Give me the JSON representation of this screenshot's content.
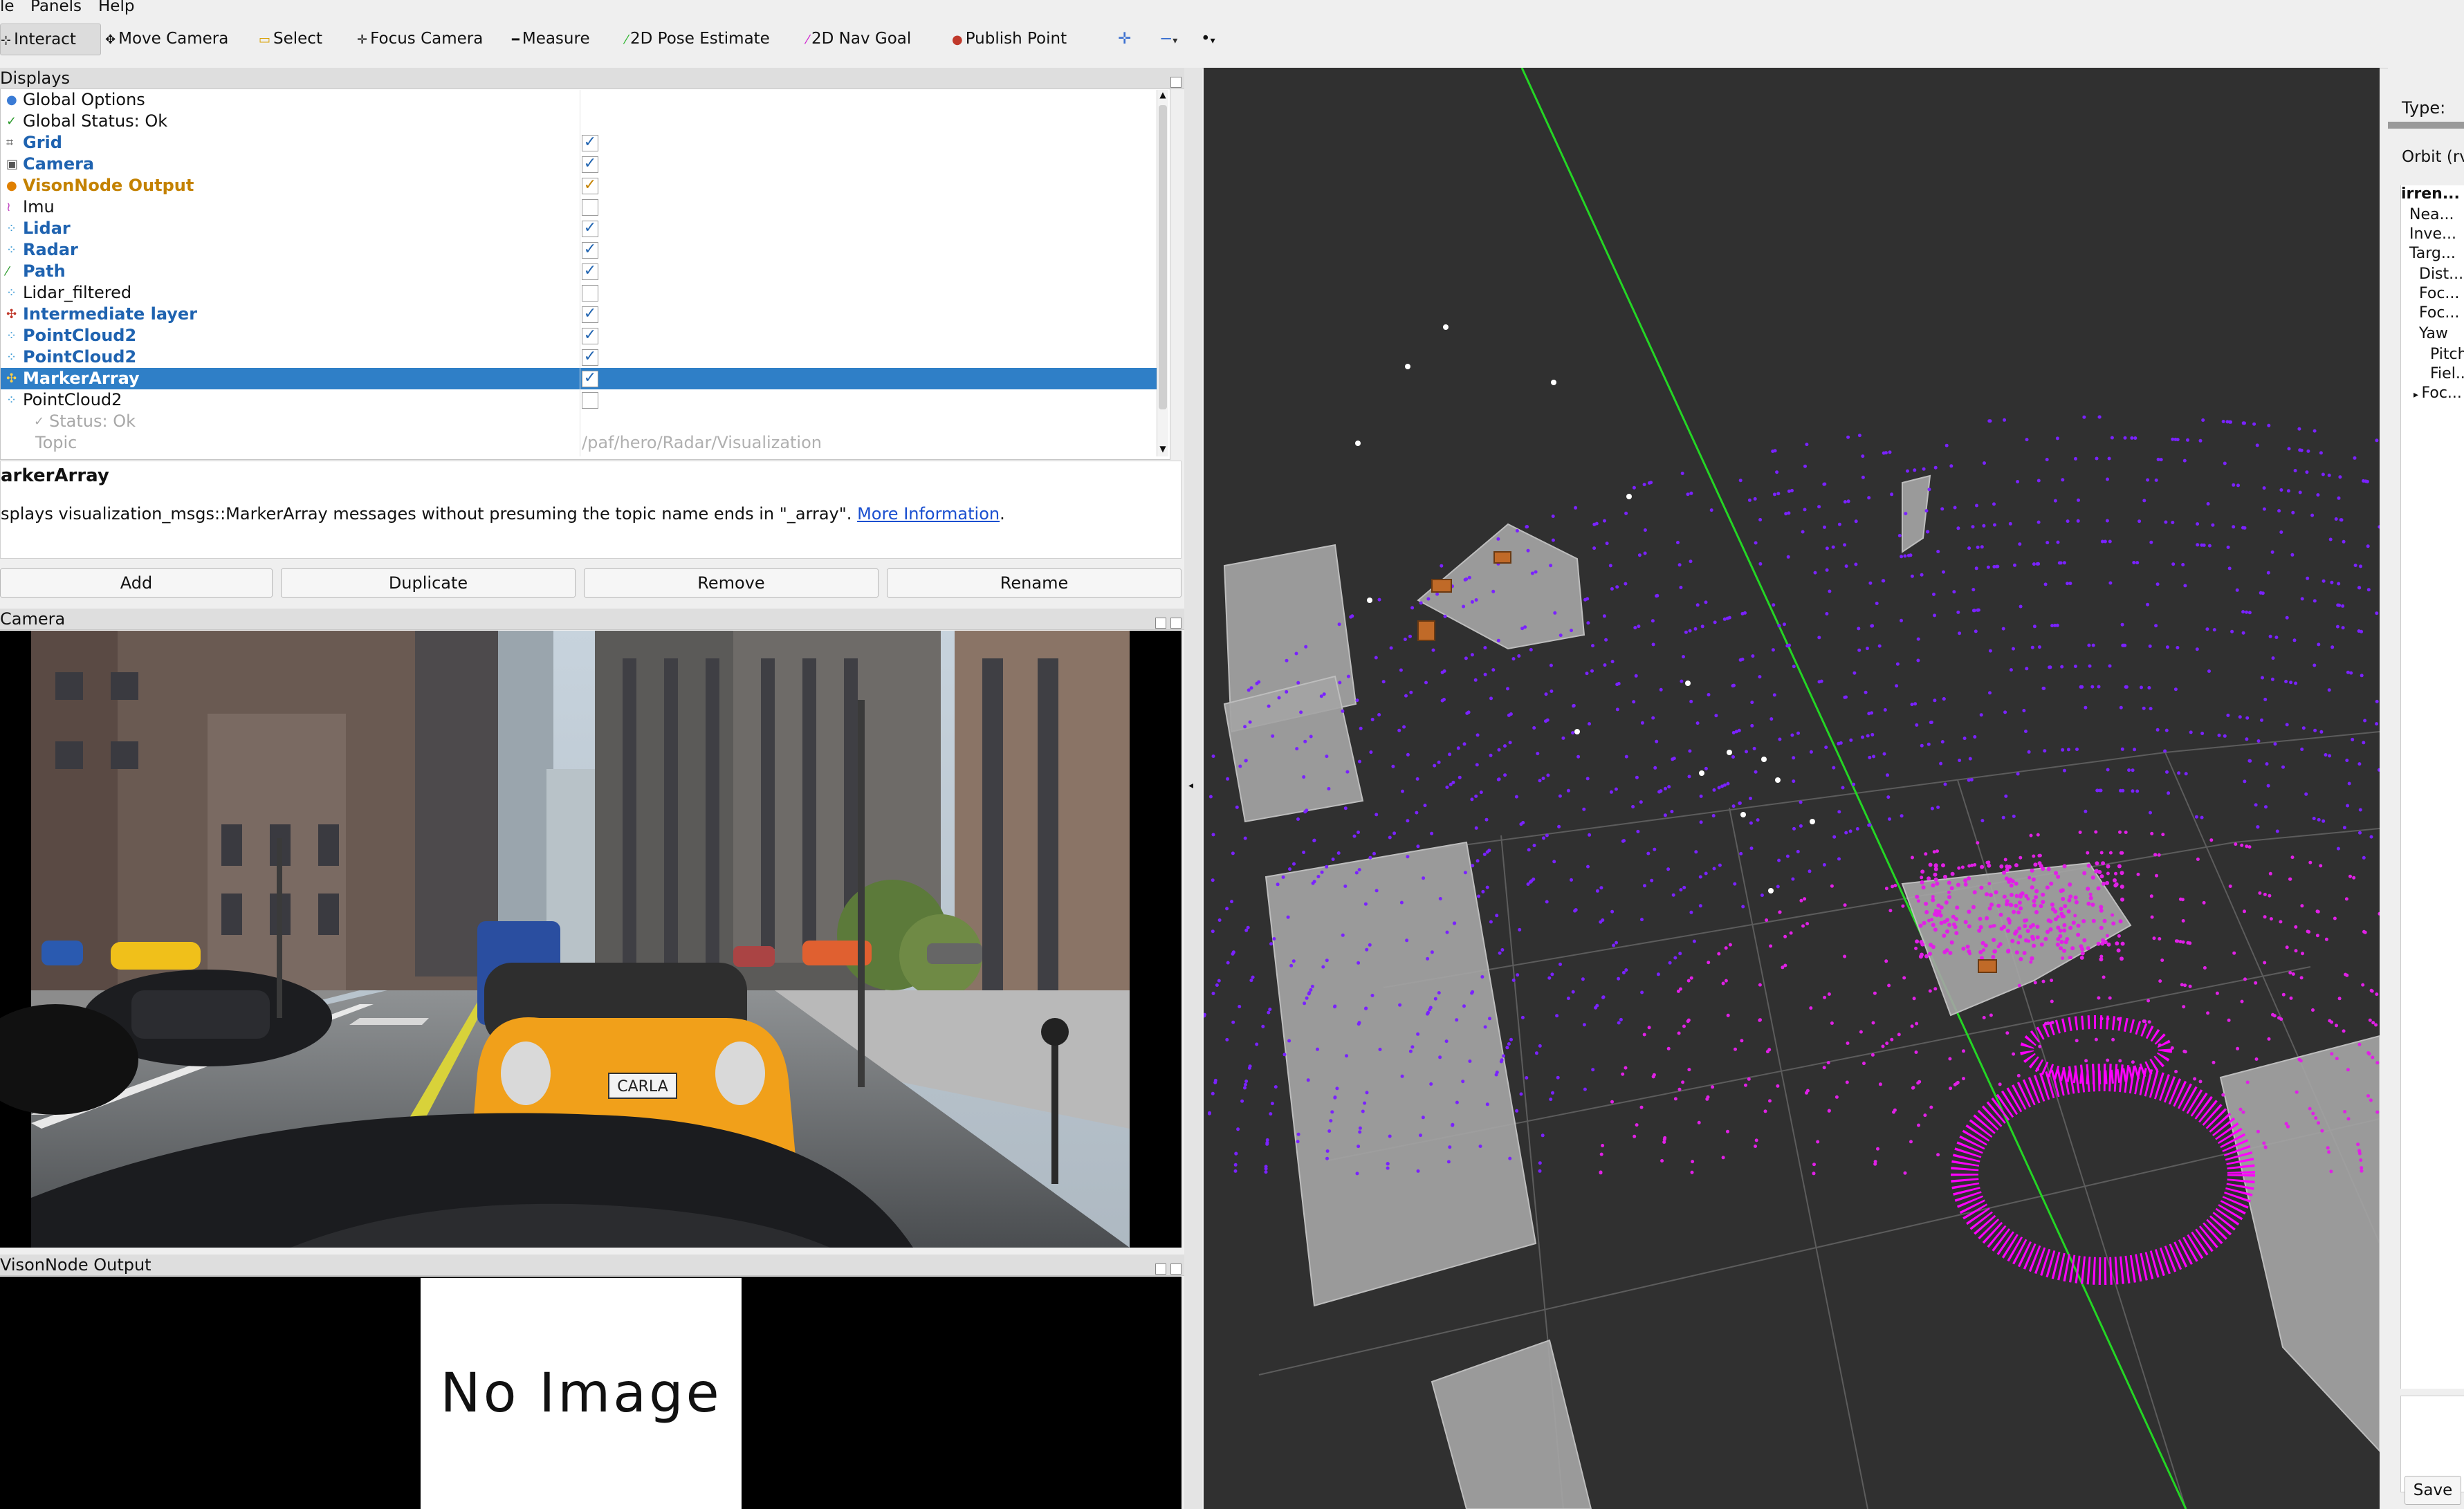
{
  "menu": [
    "le",
    "Panels",
    "Help"
  ],
  "toolbar": {
    "items": [
      {
        "label": "Interact",
        "icon": "interact-icon"
      },
      {
        "label": "Move Camera",
        "icon": "move-camera-icon"
      },
      {
        "label": "Select",
        "icon": "select-icon"
      },
      {
        "label": "Focus Camera",
        "icon": "focus-camera-icon"
      },
      {
        "label": "Measure",
        "icon": "measure-icon"
      },
      {
        "label": "2D Pose Estimate",
        "icon": "pose-estimate-icon"
      },
      {
        "label": "2D Nav Goal",
        "icon": "nav-goal-icon"
      },
      {
        "label": "Publish Point",
        "icon": "publish-point-icon"
      }
    ]
  },
  "displays_panel": {
    "title": "Displays",
    "rows": [
      {
        "label": "Global Options",
        "icon": "globe-icon",
        "style": "normal",
        "checked": null
      },
      {
        "label": "Global Status: Ok",
        "icon": "check-icon",
        "style": "normal",
        "checked": null
      },
      {
        "label": "Grid",
        "icon": "grid-icon",
        "style": "bold",
        "checked": true
      },
      {
        "label": "Camera",
        "icon": "camera-icon",
        "style": "bold",
        "checked": true
      },
      {
        "label": "VisonNode Output",
        "icon": "image-icon",
        "style": "warn",
        "checked": true
      },
      {
        "label": "Imu",
        "icon": "imu-icon",
        "style": "normal",
        "checked": false
      },
      {
        "label": "Lidar",
        "icon": "pointcloud-icon",
        "style": "bold",
        "checked": true
      },
      {
        "label": "Radar",
        "icon": "pointcloud-icon",
        "style": "bold",
        "checked": true
      },
      {
        "label": "Path",
        "icon": "path-icon",
        "style": "bold",
        "checked": true
      },
      {
        "label": "Lidar_filtered",
        "icon": "pointcloud-icon",
        "style": "normal",
        "checked": false
      },
      {
        "label": "Intermediate layer",
        "icon": "marker-icon",
        "style": "bold",
        "checked": true
      },
      {
        "label": "PointCloud2",
        "icon": "pointcloud-icon",
        "style": "bold",
        "checked": true
      },
      {
        "label": "PointCloud2",
        "icon": "pointcloud-icon",
        "style": "bold",
        "checked": true
      },
      {
        "label": "MarkerArray",
        "icon": "marker-icon",
        "style": "selected",
        "checked": true
      },
      {
        "label": "PointCloud2",
        "icon": "pointcloud-icon",
        "style": "normal",
        "checked": false
      },
      {
        "label": "Status: Ok",
        "icon": "check-icon",
        "style": "dim",
        "checked": null
      },
      {
        "label": "Topic",
        "icon": "",
        "style": "dim",
        "checked": null,
        "value": "/paf/hero/Radar/Visualization"
      }
    ]
  },
  "description": {
    "title": "arkerArray",
    "text": "splays visualization_msgs::MarkerArray messages without presuming the topic name ends in \"_array\".",
    "link": "More Information",
    "suffix": "."
  },
  "buttons": {
    "add": "Add",
    "duplicate": "Duplicate",
    "remove": "Remove",
    "rename": "Rename"
  },
  "camera_panel": {
    "title": "Camera",
    "plate": "CARLA"
  },
  "vision_panel": {
    "title": "VisonNode Output",
    "no_image": "No Image"
  },
  "views_panel": {
    "type_label": "Type:",
    "orbit": "Orbit (rv",
    "current": "irren...",
    "props": [
      "Nea...",
      "Inve...",
      "Targ...",
      "Dist...",
      "Foc...",
      "Foc...",
      "Yaw",
      "Pitch",
      "Fiel...",
      "Foc..."
    ],
    "save": "Save"
  },
  "colors": {
    "selection": "#2f7fc7",
    "point_magenta": "#e020e6",
    "point_violet": "#7a22ff",
    "path_green": "#24d524",
    "grid_bg": "#303030"
  }
}
